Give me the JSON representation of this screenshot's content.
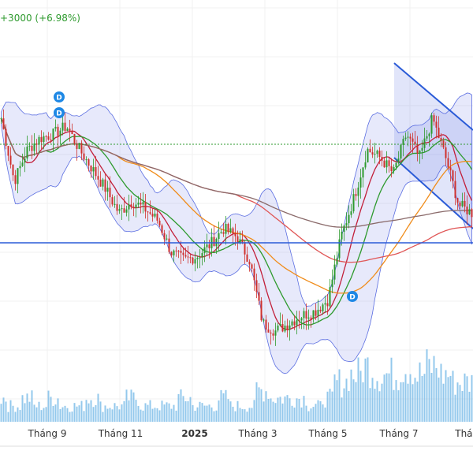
{
  "header": {
    "change_text": "+3000 (+6.98%)"
  },
  "colors": {
    "up": "#2e9a2e",
    "down": "#d0312d",
    "band": "#5b6ee1",
    "hline": "#2a5bd7",
    "volume": "#6fb6e6"
  },
  "chart_data": {
    "type": "candlestick",
    "title": "",
    "xlabel": "",
    "ylabel": "",
    "x_ticks": [
      "Tháng 9",
      "Tháng 11",
      "2025",
      "Tháng 3",
      "Tháng 5",
      "Tháng 7",
      "Tháng"
    ],
    "close_relative": [
      45,
      37,
      41,
      42.5,
      43,
      44,
      41,
      38.5,
      36,
      33,
      34.5,
      33.5,
      32,
      28,
      27,
      27.5,
      29,
      31,
      30,
      27,
      19,
      18,
      19,
      20,
      20.5,
      22,
      30,
      35,
      41,
      40,
      38,
      43,
      40,
      45,
      40,
      34,
      33
    ],
    "horizontal_levels": [
      29.2,
      41.7
    ],
    "volume_relative": [
      3,
      2,
      3,
      2,
      3,
      2,
      2,
      3,
      2,
      2,
      3,
      2,
      2,
      2,
      3,
      2,
      2,
      3,
      2,
      2,
      4,
      3,
      3,
      3,
      2,
      3,
      5,
      6,
      7,
      6,
      6,
      7,
      6,
      7,
      6,
      5,
      5
    ],
    "markers": [
      "D",
      "D",
      "D"
    ],
    "indicators": [
      "Bollinger Bands",
      "MA10",
      "MA20",
      "MA50",
      "MA100",
      "MA200"
    ],
    "legend": "none"
  }
}
